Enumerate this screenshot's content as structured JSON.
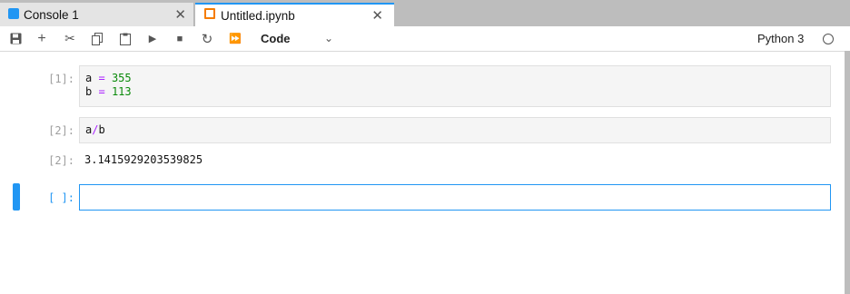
{
  "tabs": [
    {
      "label": "Console 1",
      "close": "✕"
    },
    {
      "label": "Untitled.ipynb",
      "close": "✕"
    }
  ],
  "toolbar": {
    "save": "💾",
    "add": "+",
    "cut": "✂",
    "copy": "⧉",
    "paste": "📋",
    "run": "▶",
    "stop": "■",
    "restart": "↻",
    "run_all": "⏩",
    "cell_type": "Code",
    "cell_type_chevron": "⌄",
    "kernel": "Python 3"
  },
  "cells": [
    {
      "prompt": "[1]:",
      "lines": [
        {
          "var": "a",
          "op": "=",
          "val": "355"
        },
        {
          "var": "b",
          "op": "=",
          "val": "113"
        }
      ]
    },
    {
      "prompt": "[2]:",
      "code": {
        "left": "a",
        "op": "/",
        "right": "b"
      }
    },
    {
      "output_prompt": "[2]:",
      "output": "3.1415929203539825"
    },
    {
      "prompt": "[ ]:"
    }
  ]
}
